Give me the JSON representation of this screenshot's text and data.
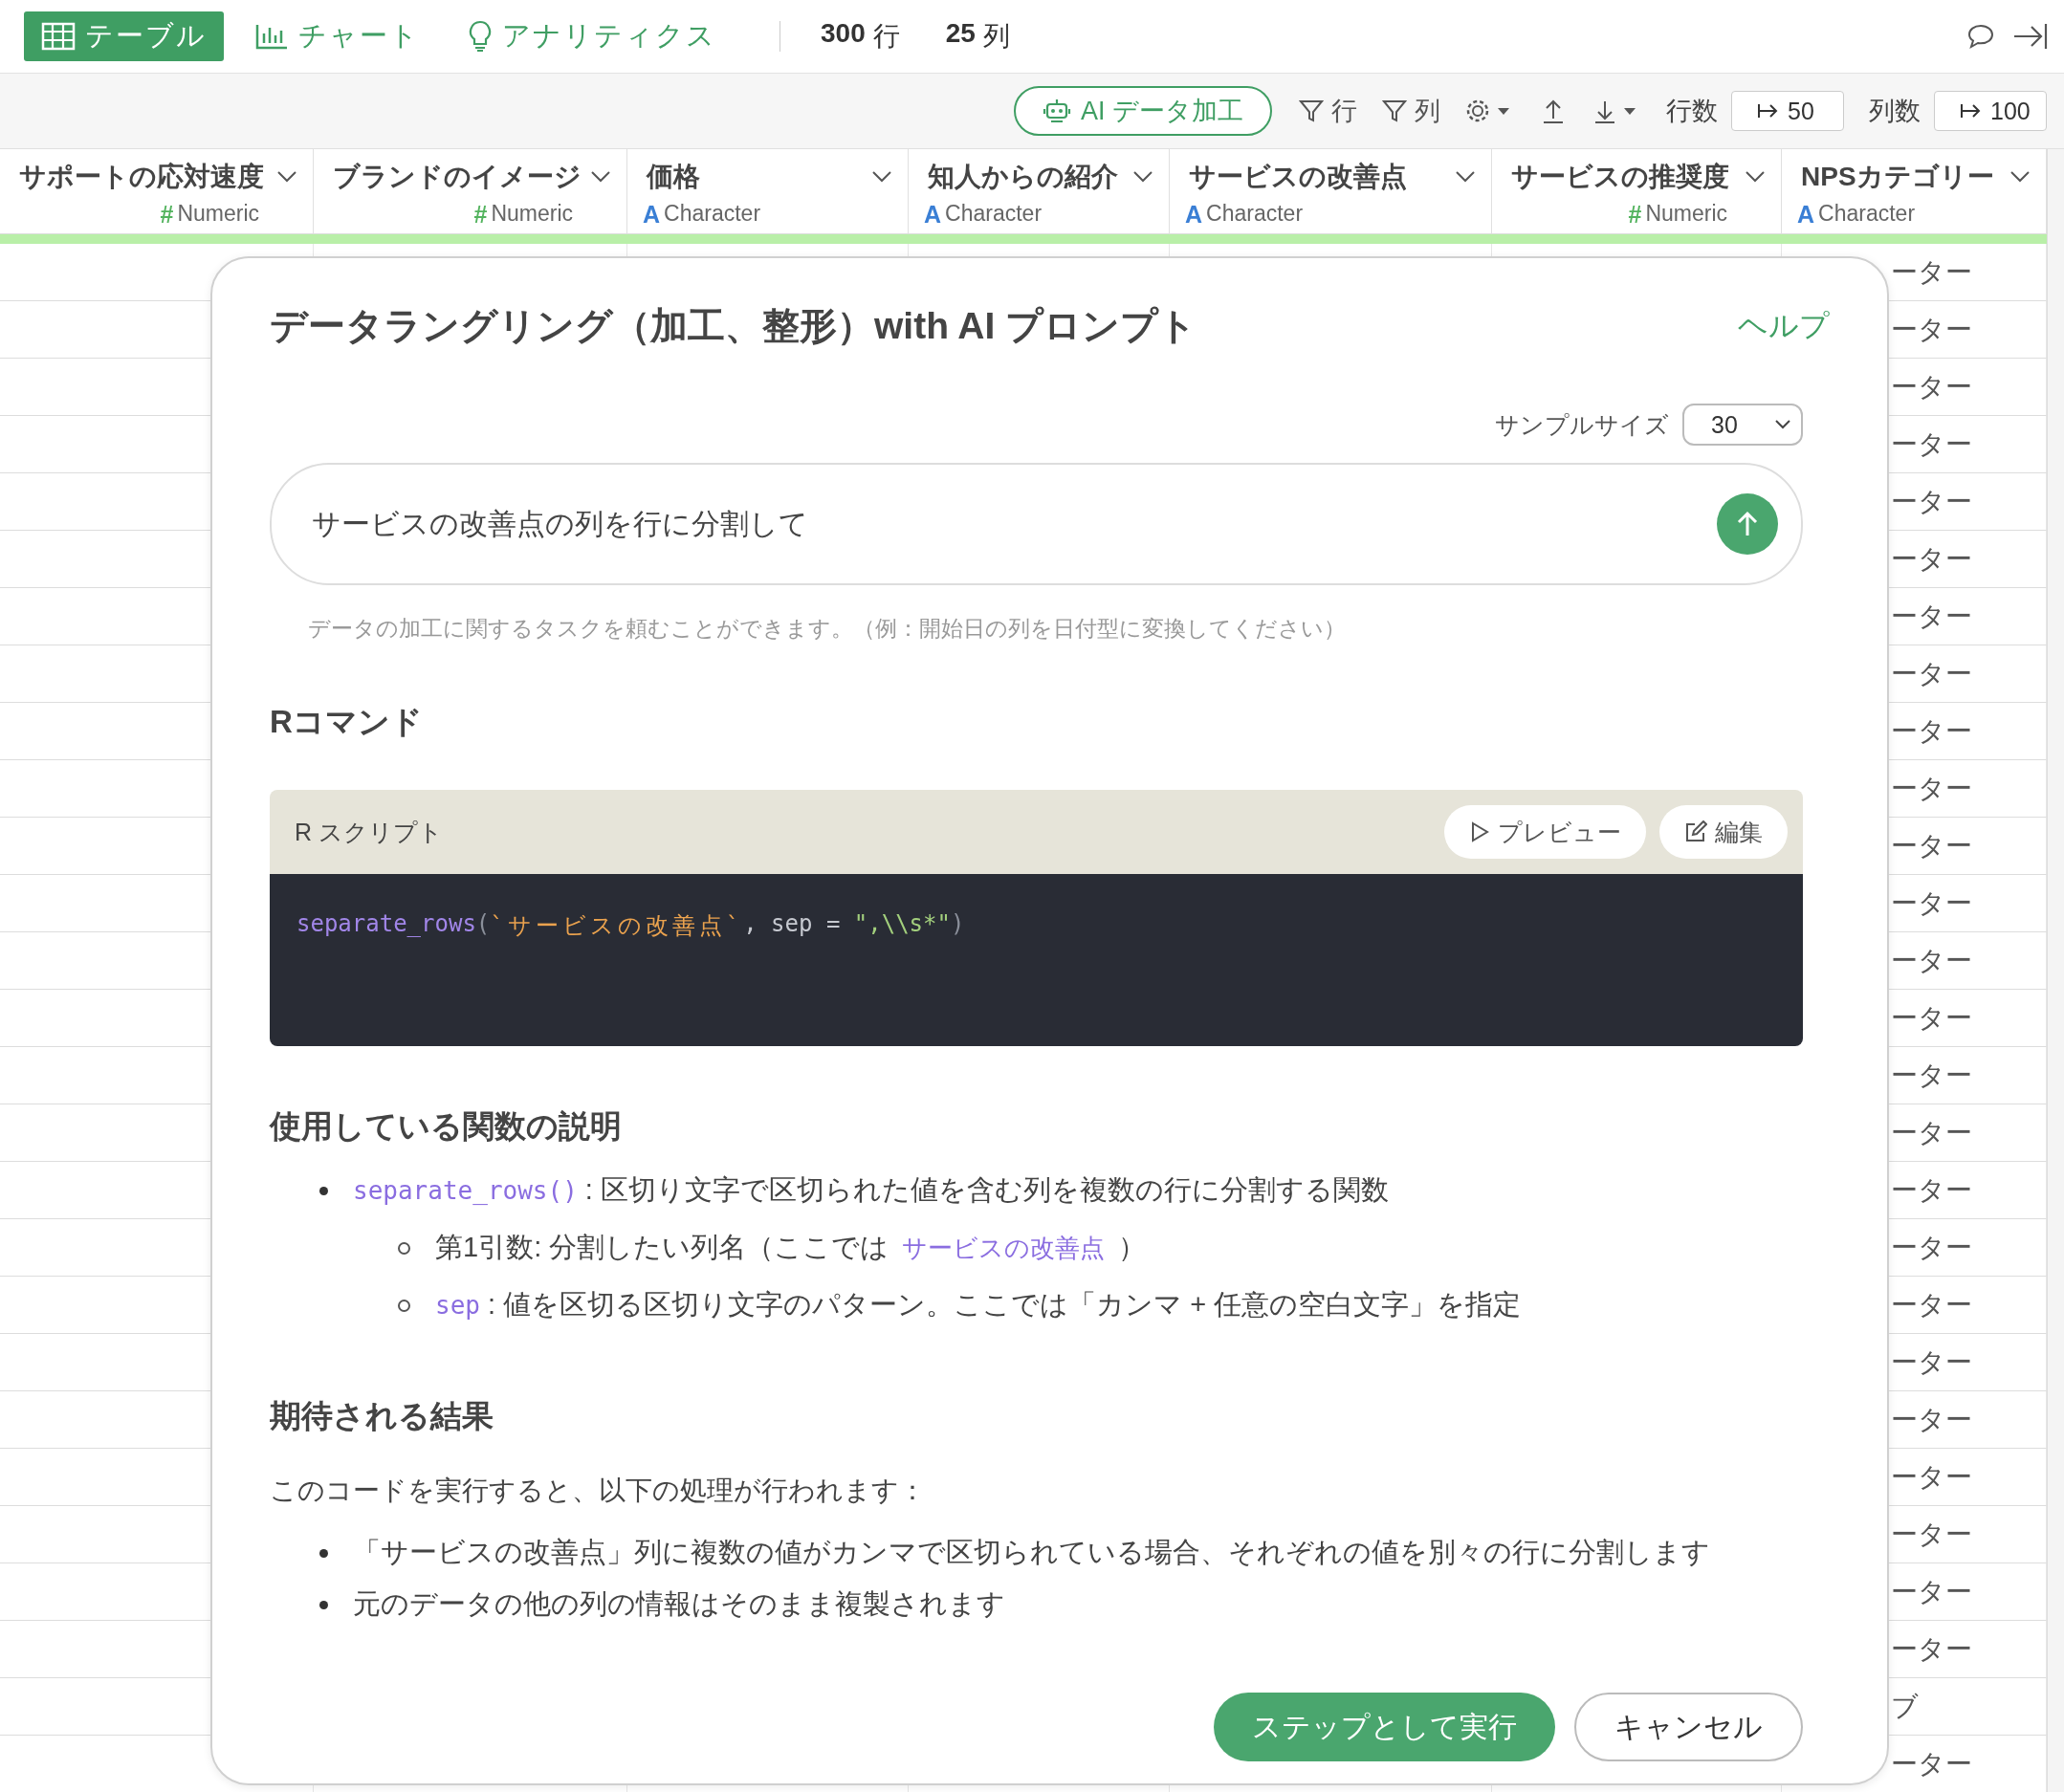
{
  "topbar": {
    "tabs": [
      {
        "label": "テーブル",
        "selected": true
      },
      {
        "label": "チャート",
        "selected": false
      },
      {
        "label": "アナリティクス",
        "selected": false
      }
    ],
    "counts": [
      {
        "value": "300",
        "unit": "行"
      },
      {
        "value": "25",
        "unit": "列"
      }
    ]
  },
  "toolbar": {
    "ai_button": "AI データ加工",
    "filters": [
      {
        "label": "行"
      },
      {
        "label": "列"
      }
    ],
    "row_count": {
      "label": "行数",
      "value": "50"
    },
    "column_count": {
      "label": "列数",
      "value": "100"
    }
  },
  "table": {
    "columns": [
      {
        "name": "サポートの応対速度",
        "type": "Numeric",
        "type_symbol": "#",
        "kind": "numeric"
      },
      {
        "name": "ブランドのイメージ",
        "type": "Numeric",
        "type_symbol": "#",
        "kind": "numeric"
      },
      {
        "name": "価格",
        "type": "Character",
        "type_symbol": "A",
        "kind": "character"
      },
      {
        "name": "知人からの紹介",
        "type": "Character",
        "type_symbol": "A",
        "kind": "character"
      },
      {
        "name": "サービスの改善点",
        "type": "Character",
        "type_symbol": "A",
        "kind": "character"
      },
      {
        "name": "サービスの推奨度",
        "type": "Numeric",
        "type_symbol": "#",
        "kind": "numeric"
      },
      {
        "name": "NPSカテゴリー",
        "type": "Character",
        "type_symbol": "A",
        "kind": "character"
      }
    ],
    "rows": [
      {
        "column_7": "ーター"
      },
      {
        "column_7": "ーター"
      },
      {
        "column_7": "ーター"
      },
      {
        "column_7": "ーター"
      },
      {
        "column_7": "ーター"
      },
      {
        "column_7": "ーター"
      },
      {
        "column_7": "ーター"
      },
      {
        "column_7": "ーター"
      },
      {
        "column_7": "ーター"
      },
      {
        "column_7": "ーター"
      },
      {
        "column_7": "ーター"
      },
      {
        "column_7": "ーター"
      },
      {
        "column_7": "ーター"
      },
      {
        "column_7": "ーター"
      },
      {
        "column_7": "ーター"
      },
      {
        "column_7": "ーター"
      },
      {
        "column_7": "ーター"
      },
      {
        "column_7": "ーター"
      },
      {
        "column_7": "ーター"
      },
      {
        "column_7": "ーター"
      },
      {
        "column_7": "ーター"
      },
      {
        "column_7": "ーター"
      },
      {
        "column_7": "ーター"
      },
      {
        "column_7": "ーター"
      },
      {
        "column_7": "ーター"
      },
      {
        "column_7": "ブ"
      },
      {
        "column_7": "ーター"
      }
    ]
  },
  "dialog": {
    "title": "データラングリング（加工、整形）with AI プロンプト",
    "help_link": "ヘルプ",
    "sample_size": {
      "label": "サンプルサイズ",
      "value": "30"
    },
    "prompt": {
      "value": "サービスの改善点の列を行に分割して"
    },
    "hint": "データの加工に関するタスクを頼むことができます。（例：開始日の列を日付型に変換してください）",
    "r_command": {
      "heading": "Rコマンド",
      "script_title": "R スクリプト",
      "preview_button": "プレビュー",
      "edit_button": "編集",
      "code": [
        {
          "kind": "function",
          "text": "separate_rows"
        },
        {
          "kind": "paren",
          "text": "("
        },
        {
          "kind": "name",
          "text": "`サービスの改善点`"
        },
        {
          "kind": "plain",
          "text": ", sep = "
        },
        {
          "kind": "string",
          "text": "\",\\\\s*\""
        },
        {
          "kind": "paren",
          "text": ")"
        }
      ]
    },
    "explanation": {
      "heading": "使用している関数の説明",
      "items": [
        {
          "segments": [
            {
              "kind": "code",
              "text": "separate_rows()"
            },
            {
              "kind": "text",
              "text": ": 区切り文字で区切られた値を含む列を複数の行に分割する関数"
            }
          ],
          "children": [
            {
              "segments": [
                {
                  "kind": "text",
                  "text": "第1引数: 分割したい列名（ここでは"
                },
                {
                  "kind": "link",
                  "text": "サービスの改善点"
                },
                {
                  "kind": "text",
                  "text": "）"
                }
              ]
            },
            {
              "segments": [
                {
                  "kind": "code",
                  "text": "sep"
                },
                {
                  "kind": "text",
                  "text": ": 値を区切る区切り文字のパターン。ここでは「カンマ + 任意の空白文字」を指定"
                }
              ]
            }
          ]
        }
      ]
    },
    "result": {
      "heading": "期待される結果",
      "intro": "このコードを実行すると、以下の処理が行われます：",
      "items": [
        "「サービスの改善点」列に複数の値がカンマで区切られている場合、それぞれの値を別々の行に分割します",
        "元のデータの他の列の情報はそのまま複製されます"
      ]
    },
    "buttons": [
      {
        "label": "ステップとして実行",
        "kind": "primary"
      },
      {
        "label": "キャンセル",
        "kind": "secondary"
      }
    ]
  }
}
